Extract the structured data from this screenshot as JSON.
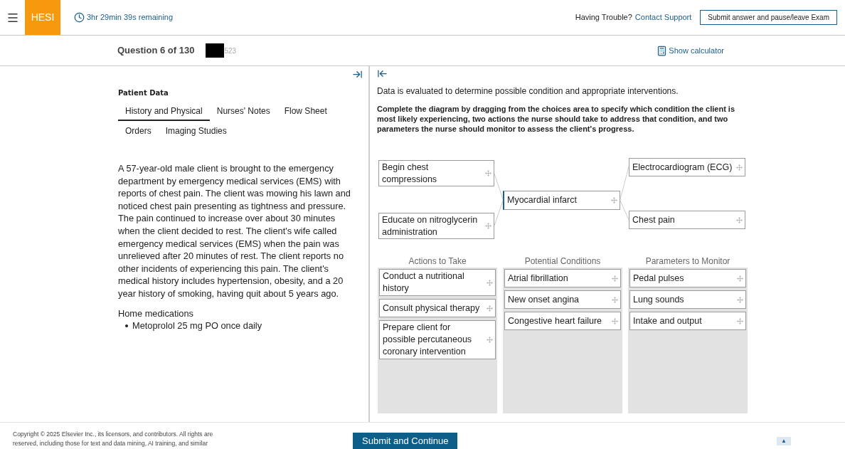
{
  "header": {
    "logo": "HESI",
    "timer": "3hr 29min 39s remaining",
    "help_text": "Having Trouble?",
    "support_link": "Contact Support",
    "exit_button": "Submit answer and pause/leave Exam"
  },
  "question_bar": {
    "label": "Question 6 of 130",
    "id_fragment": "523",
    "calculator": "Show calculator"
  },
  "patient_data": {
    "title": "Patient Data",
    "tabs": [
      {
        "label": "History and Physical",
        "selected": true
      },
      {
        "label": "Nurses' Notes",
        "selected": false
      },
      {
        "label": "Flow Sheet",
        "selected": false
      },
      {
        "label": "Orders",
        "selected": false
      },
      {
        "label": "Imaging Studies",
        "selected": false
      }
    ],
    "paragraphs": [
      "A 57-year-old male client is brought to the emergency department by emergency medical services (EMS) with reports of chest pain. The client was mowing his lawn and noticed chest pain presenting as tightness and pressure. The pain continued to increase over about 30 minutes when the client decided to rest. The client's wife called emergency medical services (EMS) when the pain was unrelieved after 20 minutes of rest. The client reports no other incidents of experiencing this pain. The client's medical history includes hypertension, obesity, and a 20 year history of smoking, having quit about 5 years ago."
    ],
    "medications_heading": "Home medications",
    "medications": [
      "Metoprolol 25 mg PO once daily"
    ]
  },
  "question": {
    "intro": "Data is evaluated to determine possible condition and appropriate interventions.",
    "instructions": "Complete the diagram by dragging from the choices area to specify which condition the client is most likely experiencing, two actions the nurse should take to address that condition, and two parameters the nurse should monitor to assess the client's progress.",
    "diagram": {
      "actions": [
        "Begin chest compressions",
        "Educate on nitroglycerin administration"
      ],
      "condition": "Myocardial infarct",
      "parameters": [
        "Electrocardiogram (ECG)",
        "Chest pain"
      ]
    },
    "choice_columns": [
      {
        "title": "Actions to Take",
        "items": [
          "Conduct a nutritional history",
          "Consult physical therapy",
          "Prepare client for possible percutaneous coronary intervention"
        ]
      },
      {
        "title": "Potential Conditions",
        "items": [
          "Atrial fibrillation",
          "New onset angina",
          "Congestive heart failure"
        ]
      },
      {
        "title": "Parameters to Monitor",
        "items": [
          "Pedal pulses",
          "Lung sounds",
          "Intake and output"
        ]
      }
    ]
  },
  "footer": {
    "copyright": "Copyright © 2025 Elsevier Inc., its licensors, and contributors. All rights are reserved, including those for text and data mining, AI training, and similar",
    "submit_button": "Submit and Continue",
    "scroll_top": "▲"
  }
}
